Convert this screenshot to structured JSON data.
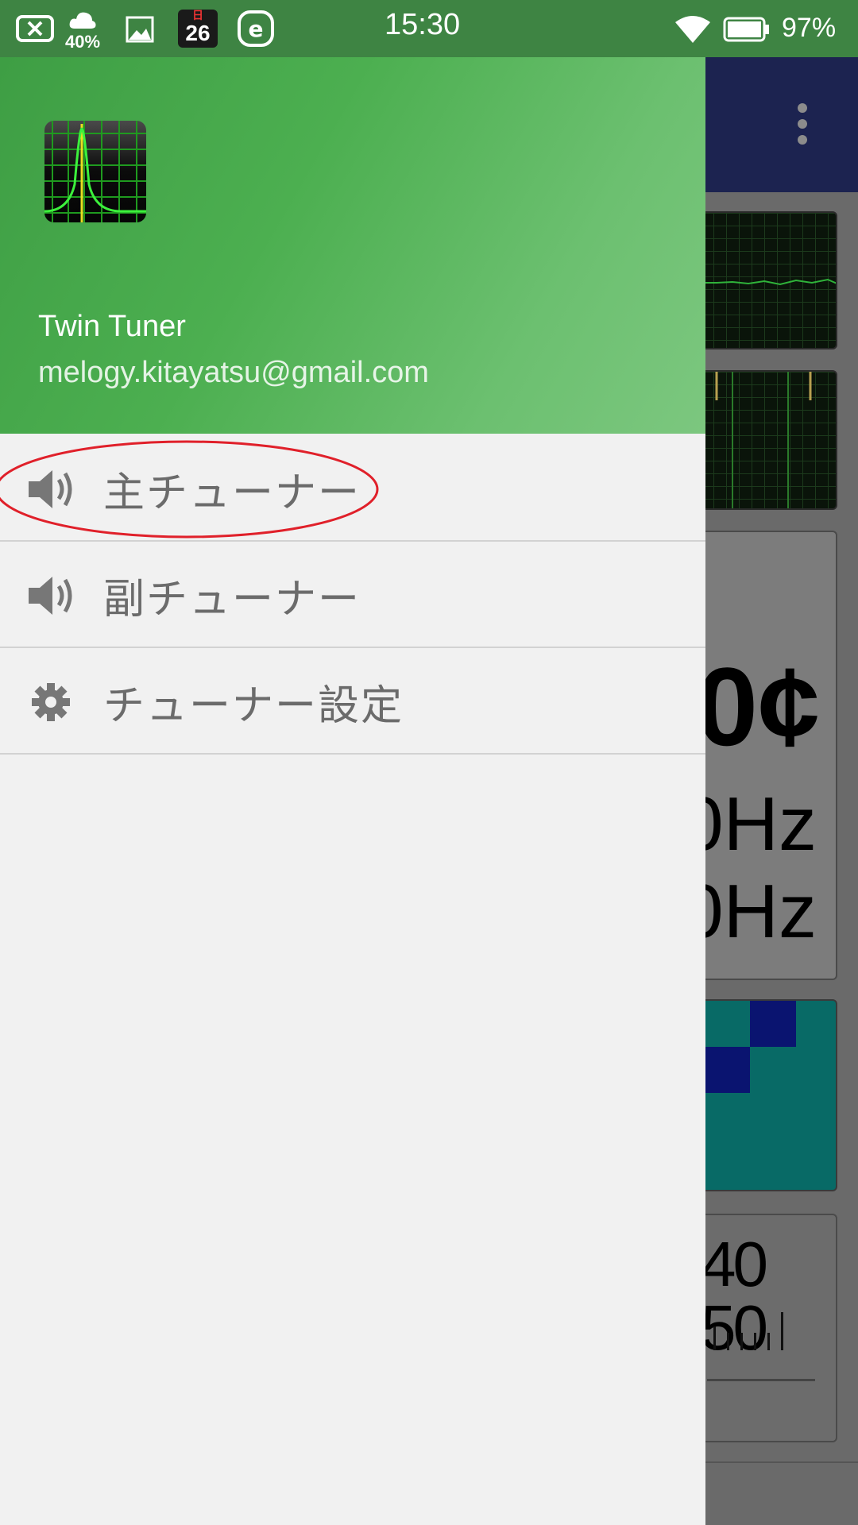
{
  "status_bar": {
    "time": "15:30",
    "battery_percent": "97%",
    "weather_percent": "40%",
    "calendar_top": "日",
    "calendar_day": "26",
    "icons": [
      "battery-x-icon",
      "weather-cloud-icon",
      "image-icon",
      "calendar-icon",
      "e-app-icon",
      "wifi-icon",
      "battery-icon"
    ]
  },
  "background_app": {
    "readout_main": "0¢",
    "readout_hz_1": "0Hz",
    "readout_hz_2": "0Hz",
    "scale_numbers": "40 50",
    "toolbar_color": "#1c2350"
  },
  "drawer": {
    "header": {
      "app_name": "Twin Tuner",
      "email": "melogy.kitayatsu@gmail.com"
    },
    "items": [
      {
        "label": "主チューナー",
        "icon": "speaker-icon",
        "highlighted": true
      },
      {
        "label": "副チューナー",
        "icon": "speaker-icon",
        "highlighted": false
      },
      {
        "label": "チューナー設定",
        "icon": "gear-icon",
        "highlighted": false
      }
    ]
  },
  "colors": {
    "accent": "#4caf50",
    "status_bar": "#3e8443",
    "highlight_ring": "#e0202a"
  }
}
